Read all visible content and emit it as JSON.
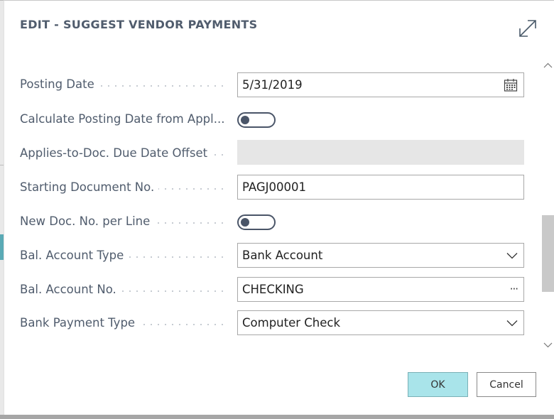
{
  "dialog": {
    "title": "EDIT - SUGGEST VENDOR PAYMENTS"
  },
  "fields": {
    "posting_date": {
      "label": "Posting Date",
      "value": "5/31/2019"
    },
    "calc_posting_date": {
      "label": "Calculate Posting Date from Appl...",
      "on": false
    },
    "due_date_offset": {
      "label": "Applies-to-Doc. Due Date Offset",
      "value": ""
    },
    "starting_doc_no": {
      "label": "Starting Document No.",
      "value": "PAGJ00001"
    },
    "new_doc_per_line": {
      "label": "New Doc. No. per Line",
      "on": false
    },
    "bal_account_type": {
      "label": "Bal. Account Type",
      "value": "Bank Account"
    },
    "bal_account_no": {
      "label": "Bal. Account No.",
      "value": "CHECKING",
      "lookup": "···"
    },
    "bank_payment_type": {
      "label": "Bank Payment Type",
      "value": "Computer Check"
    }
  },
  "buttons": {
    "ok": "OK",
    "cancel": "Cancel"
  },
  "icons": {
    "expand": "expand-icon",
    "calendar": "calendar-icon",
    "dropdown": "chevron-down-icon",
    "scroll_up": "chevron-up-icon",
    "scroll_down": "chevron-down-icon"
  },
  "colors": {
    "label": "#505c6d",
    "ok_button": "#a9e4ea",
    "toggle": "#4a5568",
    "readonly_field": "#e6e6e6"
  }
}
